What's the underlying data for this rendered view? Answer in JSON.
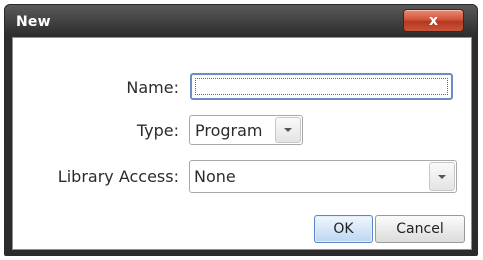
{
  "window": {
    "title": "New",
    "close_symbol": "x"
  },
  "form": {
    "name_label": "Name:",
    "name_value": "",
    "type_label": "Type:",
    "type_value": "Program",
    "library_label": "Library Access:",
    "library_value": "None"
  },
  "buttons": {
    "ok": "OK",
    "cancel": "Cancel"
  },
  "icons": {
    "dropdown": "chevron-down-icon",
    "close": "close-icon"
  }
}
